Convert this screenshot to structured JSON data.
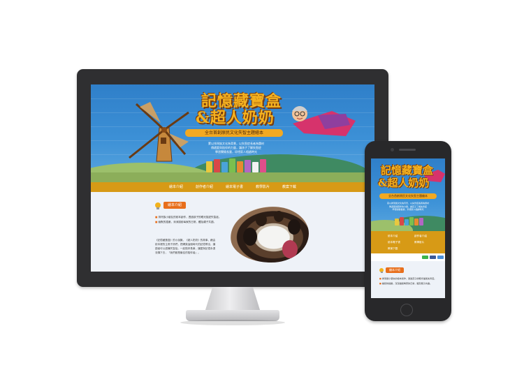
{
  "site": {
    "title_line1": "記憶藏寶盒",
    "title_line2": "&超人奶奶",
    "subtitle": "全台首創原民文化失智主題繪本",
    "description": [
      "蒙以排灣族文化為背景，以失智症長者為題材",
      "傳遞愛與陪伴的力量，讓孩子了解失智症",
      "學習關懷長輩，珍惜家人相處時光"
    ],
    "nav": [
      "繪本介紹",
      "創作者介紹",
      "繪本電子書",
      "教學影片",
      "教案下載"
    ],
    "mobile_nav": [
      "繪本介紹",
      "創作者介紹",
      "繪本電子書",
      "教學影片",
      "教案下載"
    ],
    "section_heading": "繪本介紹",
    "bullets": [
      "排灣族小朋友的繪本創作，透過孩子的眼光描述失智症。",
      "幽默的插畫，深深描繪每家的日常，觸及親子共讀。"
    ],
    "paragraph": "《記憶藏寶盒》的小說篇，《超人奶奶》的故事，藉由繪本裡的主角子孫們，把網頁這個時代的記憶帶出，讓讀者可以認識失智症。一起陪伴長輩，讓愛與記憶永遠流傳下去，「我們都是最佳的陪伴者」。",
    "mobile_bullets": [
      "排灣族小朋友的繪本創作，透過孩子的眼光描述失智症。",
      "幽默的插畫，深深描繪每家的日常，觸及親子共讀。"
    ]
  },
  "colors": {
    "sky": "#3c90d6",
    "nav": "#d79a16",
    "heading_badge": "#e86f1c",
    "title": "#f5b21f",
    "content_bg": "#eef2f8",
    "device_body": "#2f2f31"
  },
  "icons": [
    "bulb-icon",
    "home-button-icon",
    "camera-icon",
    "speaker-icon"
  ]
}
